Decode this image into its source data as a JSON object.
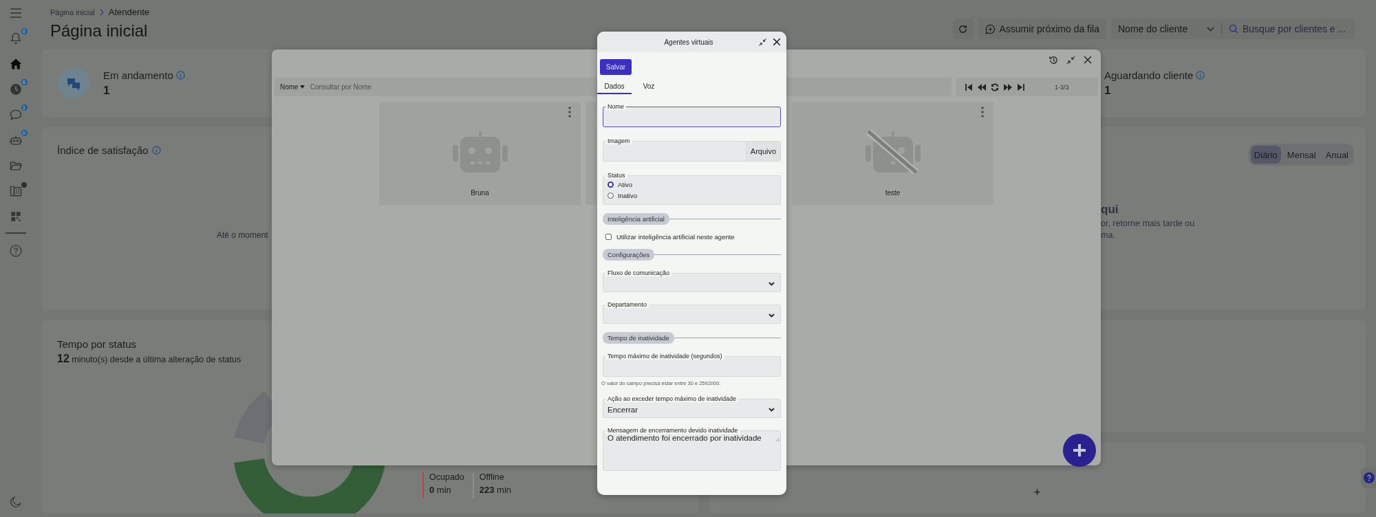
{
  "sidebar": {
    "items": [
      {
        "selected": false,
        "badge": "0"
      },
      {
        "selected": true
      },
      {
        "selected": false,
        "badge": "6"
      },
      {
        "selected": false,
        "badge": "1"
      },
      {
        "selected": false,
        "badge": "0"
      },
      {
        "selected": false
      },
      {
        "selected": false,
        "dot": true
      },
      {
        "selected": false
      }
    ]
  },
  "header": {
    "breadcrumb": [
      "Página inicial",
      "Atendente"
    ],
    "title": "Página inicial",
    "next_button": "Assumir próximo da fila",
    "client_select": "Nome do cliente",
    "search": {
      "placeholder": "Busque por clientes e ..."
    }
  },
  "stats": [
    {
      "label": "Em andamento",
      "value": "1"
    },
    {
      "label": "Aguardando cliente",
      "value": "1"
    }
  ],
  "satisfaction": {
    "title": "Índice de satisfação",
    "empty_text": "Até o moment"
  },
  "period_panel": {
    "periods": [
      {
        "label": "Diário",
        "selected": true
      },
      {
        "label": "Mensal",
        "selected": false
      },
      {
        "label": "Anual",
        "selected": false
      }
    ],
    "empty_title": "qui",
    "empty_lines": [
      "or, retorne mais tarde ou",
      "ma."
    ]
  },
  "status_time": {
    "title": "Tempo por status",
    "minutes": "12",
    "caption": "minuto(s) desde a última alteração de status",
    "legend": [
      {
        "label": "Ocupado",
        "value": "0",
        "unit": "min",
        "color": "#b8473a"
      },
      {
        "label": "Offline",
        "value": "223",
        "unit": "min",
        "color": "#8c8e8c"
      }
    ]
  },
  "add_card": {
    "label": "+"
  },
  "agents_window": {
    "filter": "Nome",
    "search": {
      "placeholder": "Consultar por Nome"
    },
    "range": "1-3/3",
    "agents": [
      {
        "name": "Bruna",
        "active": true
      },
      {
        "name": "teste",
        "active": false
      }
    ]
  },
  "form_window": {
    "title": "Agentes virtuais",
    "save": "Salvar",
    "tabs": [
      {
        "label": "Dados",
        "selected": true
      },
      {
        "label": "Voz",
        "selected": false
      }
    ],
    "fields": [
      {
        "kind": "input",
        "label": "Nome",
        "focused": true
      },
      {
        "kind": "file",
        "label": "Imagem",
        "button": "Arquivo"
      },
      {
        "kind": "radio",
        "label": "Status",
        "options": [
          {
            "label": "Ativo",
            "selected": true
          },
          {
            "label": "Inativo",
            "selected": false
          }
        ]
      },
      {
        "kind": "section",
        "label": "Inteligência artificial"
      },
      {
        "kind": "checkbox",
        "label": "Utilizar inteligência artificial neste agente",
        "checked": false
      },
      {
        "kind": "section",
        "label": "Configurações"
      },
      {
        "kind": "select",
        "label": "Fluxo de comunicação"
      },
      {
        "kind": "select",
        "label": "Departamento"
      },
      {
        "kind": "section",
        "label": "Tempo de inatividade"
      },
      {
        "kind": "input",
        "label": "Tempo máximo de inatividade (segundos)",
        "focused": false,
        "hint": "O valor do campo precisa estar entre 30 e 2592000."
      },
      {
        "kind": "select",
        "label": "Ação ao exceder tempo máximo de inatividade",
        "value": "Encerrar"
      },
      {
        "kind": "textarea",
        "label": "Mensagem de encerramento devido inatividade",
        "value": "O atendimento foi encerrado por inatividade"
      }
    ]
  }
}
